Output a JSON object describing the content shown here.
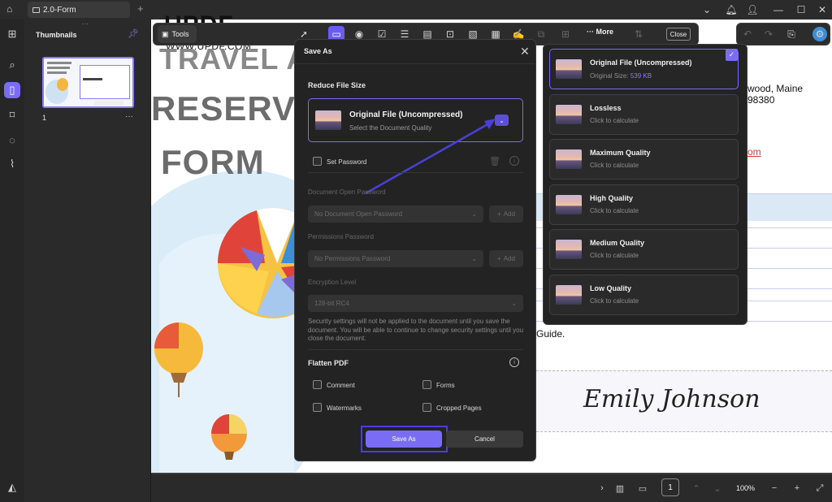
{
  "titlebar": {
    "tab_label": "2.0-Form",
    "add_tab": "+"
  },
  "rail": {
    "active": "pages"
  },
  "thumbnails": {
    "title": "Thumbnails",
    "page_number": "1",
    "more": "···"
  },
  "toolbar": {
    "tools_label": "Tools",
    "more_label": "More",
    "close_label": "Close"
  },
  "document": {
    "logo": "UPDF",
    "url": "WWW.UPDF.COM",
    "title_line1": "TRAVEL A",
    "title_line2": "RESERVA",
    "title_line3": "FORM",
    "address_fragment": "wood, Maine 98380",
    "link_fragment": "om",
    "guide_fragment": "Guide.",
    "signature": "Emily Johnson"
  },
  "dialog": {
    "title": "Save As",
    "reduce_label": "Reduce File Size",
    "selected_quality_title": "Original File (Uncompressed)",
    "selected_quality_sub": "Select the Document Quality",
    "set_password_label": "Set Password",
    "open_pw_label": "Document Open Password",
    "open_pw_placeholder": "No Document Open Password",
    "add_label": "Add",
    "perm_pw_label": "Permissions Password",
    "perm_pw_placeholder": "No Permissions Password",
    "encryption_label": "Encryption Level",
    "encryption_value": "128-bit RC4",
    "security_note": "Security settings will not be applied to the document until you save the document. You will be able to continue to change security settings until you close the document.",
    "flatten_label": "Flatten PDF",
    "flatten_options": [
      "Comment",
      "Forms",
      "Watermarks",
      "Cropped Pages"
    ],
    "save_label": "Save As",
    "cancel_label": "Cancel"
  },
  "quality_menu": {
    "options": [
      {
        "title": "Original File (Uncompressed)",
        "sub": "Original Size:",
        "size": "539 KB",
        "selected": true
      },
      {
        "title": "Lossless",
        "sub": "Click to calculate"
      },
      {
        "title": "Maximum Quality",
        "sub": "Click to calculate"
      },
      {
        "title": "High Quality",
        "sub": "Click to calculate"
      },
      {
        "title": "Medium Quality",
        "sub": "Click to calculate"
      },
      {
        "title": "Low Quality",
        "sub": "Click to calculate"
      }
    ]
  },
  "bottombar": {
    "page_input": "1",
    "zoom": "100%"
  },
  "colors": {
    "accent": "#7b6cf6",
    "accent_dark": "#4b3fd9",
    "panel": "#232323"
  }
}
